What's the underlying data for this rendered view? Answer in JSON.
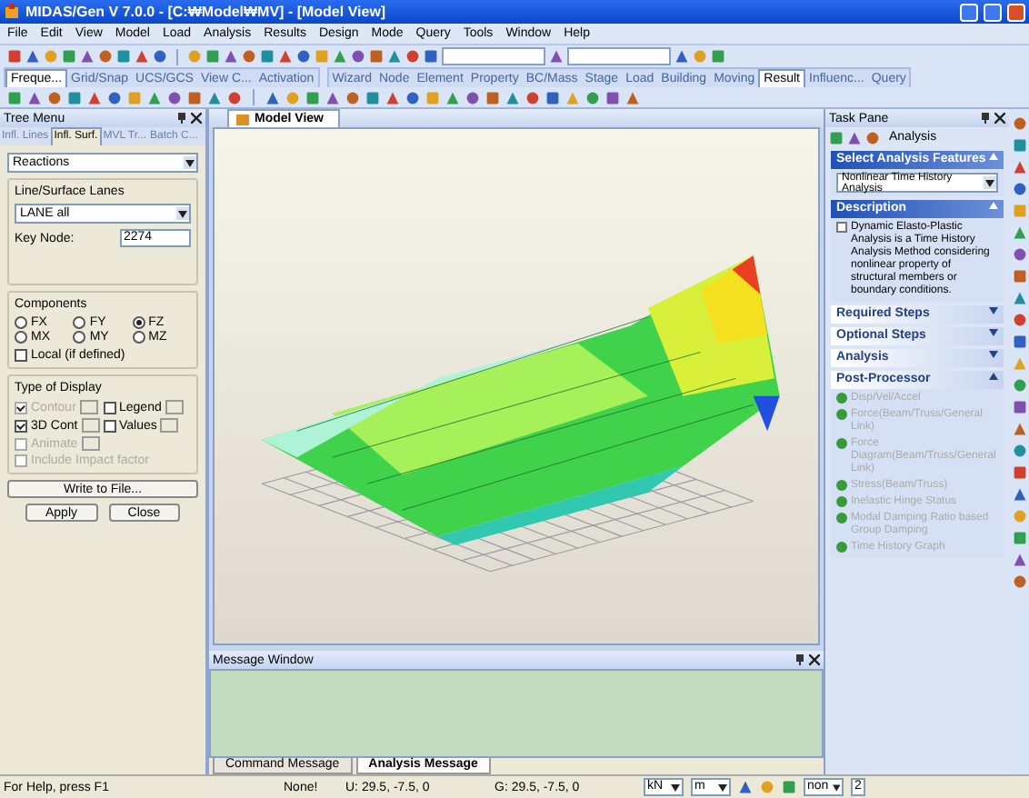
{
  "window": {
    "title": "MIDAS/Gen V 7.0.0 - [C:₩Model₩MV] - [Model View]"
  },
  "menu": [
    "File",
    "Edit",
    "View",
    "Model",
    "Load",
    "Analysis",
    "Results",
    "Design",
    "Mode",
    "Query",
    "Tools",
    "Window",
    "Help"
  ],
  "left_tabs": [
    {
      "label": "Freque...",
      "selected": true
    },
    {
      "label": "Grid/Snap",
      "selected": false
    },
    {
      "label": "UCS/GCS",
      "selected": false
    },
    {
      "label": "View C...",
      "selected": false
    },
    {
      "label": "Activation",
      "selected": false
    }
  ],
  "right_tabs": [
    {
      "label": "Wizard",
      "selected": false
    },
    {
      "label": "Node",
      "selected": false
    },
    {
      "label": "Element",
      "selected": false
    },
    {
      "label": "Property",
      "selected": false
    },
    {
      "label": "BC/Mass",
      "selected": false
    },
    {
      "label": "Stage",
      "selected": false
    },
    {
      "label": "Load",
      "selected": false
    },
    {
      "label": "Building",
      "selected": false
    },
    {
      "label": "Moving",
      "selected": false
    },
    {
      "label": "Result",
      "selected": true
    },
    {
      "label": "Influenc...",
      "selected": false
    },
    {
      "label": "Query",
      "selected": false
    }
  ],
  "tree_menu": {
    "title": "Tree Menu",
    "tabs": [
      {
        "label": "Infl. Lines",
        "selected": false
      },
      {
        "label": "Infl. Surf.",
        "selected": true
      },
      {
        "label": "MVL Tr...",
        "selected": false
      },
      {
        "label": "Batch C...",
        "selected": false
      }
    ],
    "result_type": "Reactions",
    "lanes_label": "Line/Surface Lanes",
    "lane": "LANE all",
    "key_node_label": "Key Node:",
    "key_node": "2274",
    "components_label": "Components",
    "components": [
      {
        "label": "FX",
        "selected": false
      },
      {
        "label": "FY",
        "selected": false
      },
      {
        "label": "FZ",
        "selected": true
      },
      {
        "label": "MX",
        "selected": false
      },
      {
        "label": "MY",
        "selected": false
      },
      {
        "label": "MZ",
        "selected": false
      }
    ],
    "local": {
      "label": "Local (if defined)",
      "checked": false,
      "disabled": false
    },
    "display_label": "Type of Display",
    "display": [
      {
        "label": "Contour",
        "checked": true,
        "disabled": true,
        "more": true
      },
      {
        "label": "Legend",
        "checked": false,
        "disabled": false,
        "more": true
      },
      {
        "label": "3D Cont",
        "checked": true,
        "disabled": false,
        "more": true
      },
      {
        "label": "Values",
        "checked": false,
        "disabled": false,
        "more": true
      },
      {
        "label": "Animate",
        "checked": false,
        "disabled": true,
        "more": true
      },
      {
        "label": "Include Impact factor",
        "checked": false,
        "disabled": true,
        "more": false
      }
    ],
    "buttons": [
      "Write to File...",
      "Apply",
      "Close"
    ]
  },
  "model_view": {
    "tab": "Model View"
  },
  "task_pane": {
    "title": "Task Pane",
    "mode": "Analysis",
    "sections": [
      {
        "title": "Select Analysis Features",
        "expanded": true,
        "kind": "select",
        "value": "Nonlinear Time History Analysis"
      },
      {
        "title": "Description",
        "expanded": true,
        "kind": "text",
        "text": "Dynamic Elasto-Plastic Analysis is a Time History Analysis Method considering nonlinear property of structural members or boundary conditions."
      },
      {
        "title": "Required Steps",
        "expanded": false
      },
      {
        "title": "Optional Steps",
        "expanded": false
      },
      {
        "title": "Analysis",
        "expanded": false
      },
      {
        "title": "Post-Processor",
        "expanded": true,
        "kind": "steps",
        "items": [
          {
            "label": "Disp/Vel/Accel",
            "disabled": true
          },
          {
            "label": "Force(Beam/Truss/General Link)",
            "disabled": true
          },
          {
            "label": "Force Diagram(Beam/Truss/General Link)",
            "disabled": true
          },
          {
            "label": "Stress(Beam/Truss)",
            "disabled": true
          },
          {
            "label": "Inelastic Hinge Status",
            "disabled": true
          },
          {
            "label": "Modal Damping Ratio based Group Damping",
            "disabled": true
          },
          {
            "label": "Time History Graph",
            "disabled": true
          }
        ]
      }
    ]
  },
  "message_window": {
    "title": "Message Window",
    "tabs": [
      {
        "label": "Command Message",
        "selected": false
      },
      {
        "label": "Analysis Message",
        "selected": true
      }
    ]
  },
  "status_bar": {
    "help": "For Help, press F1",
    "selection": "None!",
    "ucs": "U: 29.5, -7.5, 0",
    "gcs": "G: 29.5, -7.5, 0",
    "force_unit": "kN",
    "length_unit": "m",
    "mode": "non",
    "page": "2"
  }
}
